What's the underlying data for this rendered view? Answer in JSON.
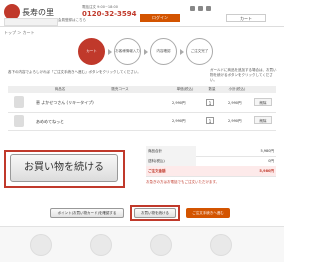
{
  "header": {
    "logo_text": "長寿の里",
    "logo_sub": "",
    "phone_label": "電話注文 9:00~18:00",
    "phone_number": "0120-32-3594",
    "login_label": "ログイン",
    "cart_label": "カート",
    "banner_text": "会員登録はこちら",
    "brand_color": "#c0392b"
  },
  "breadcrumb": "トップ ＞ カート",
  "steps": [
    {
      "label": "カート"
    },
    {
      "label": "お客様情報入力"
    },
    {
      "label": "内容確認"
    },
    {
      "label": "ご注文完了"
    }
  ],
  "notice_left": "各下の内容でよろしければ「ご注文手続きへ進む」ボタンをクリックしてください。",
  "notice_right": "ガールドに商品を追加する場合は、お買い物を続けるボタンをクリックしてください。",
  "table": {
    "headers": [
      "",
      "商品名",
      "",
      "販売コース",
      "単価(税込)",
      "数量",
      "小計(税込)",
      ""
    ],
    "rows": [
      {
        "name": "恵 よかせつさん (リキータイプ)",
        "price": "2,990円",
        "qty": "1",
        "subtotal": "2,990円",
        "delete": "削除"
      },
      {
        "name": "あめめてねっと",
        "price": "2,990円",
        "qty": "1",
        "subtotal": "2,990円",
        "delete": "削除"
      }
    ]
  },
  "summary": [
    {
      "label": "商品合計",
      "value": "5,980円"
    },
    {
      "label": "送料(税込)",
      "value": "0円"
    },
    {
      "label": "ご注文金額",
      "value": "5,980円"
    }
  ],
  "note": "お急ぎの方はお電話でもご注文いただけます。",
  "continue_big_label": "お買い物を続ける",
  "buttons": {
    "point_label": "ポイント(お買い物カード)を確認する",
    "continue_small_label": "お買い物を続ける",
    "checkout_label": "ご注文手続きへ進む"
  }
}
